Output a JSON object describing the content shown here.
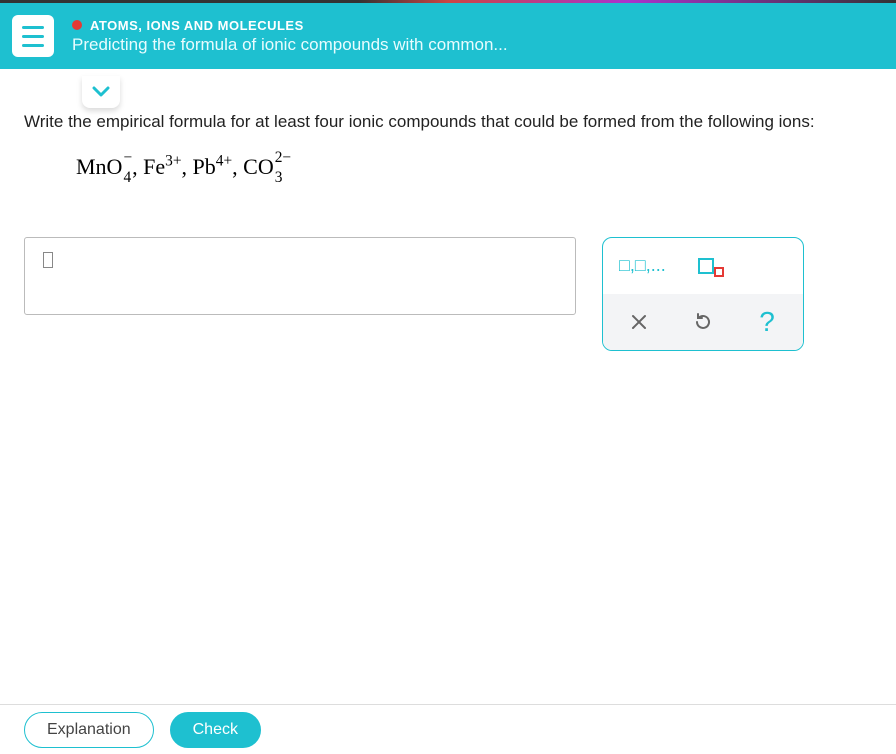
{
  "header": {
    "breadcrumb": "ATOMS, IONS AND MOLECULES",
    "title": "Predicting the formula of ionic compounds with common..."
  },
  "question": {
    "prompt": "Write the empirical formula for at least four ionic compounds that could be formed from the following ions:",
    "ions_plain": "MnO4-, Fe3+, Pb4+, CO3 2-",
    "ions": [
      {
        "base": "MnO",
        "sub": "4",
        "sup": "−"
      },
      {
        "base": "Fe",
        "sub": "",
        "sup": "3+"
      },
      {
        "base": "Pb",
        "sub": "",
        "sup": "4+"
      },
      {
        "base": "CO",
        "sub": "3",
        "sup": "2−"
      }
    ]
  },
  "tools": {
    "list_label": "□,□,...",
    "subscript_label": "subscript",
    "clear_label": "clear",
    "reset_label": "reset",
    "help_label": "?"
  },
  "footer": {
    "explanation_label": "Explanation",
    "check_label": "Check"
  }
}
